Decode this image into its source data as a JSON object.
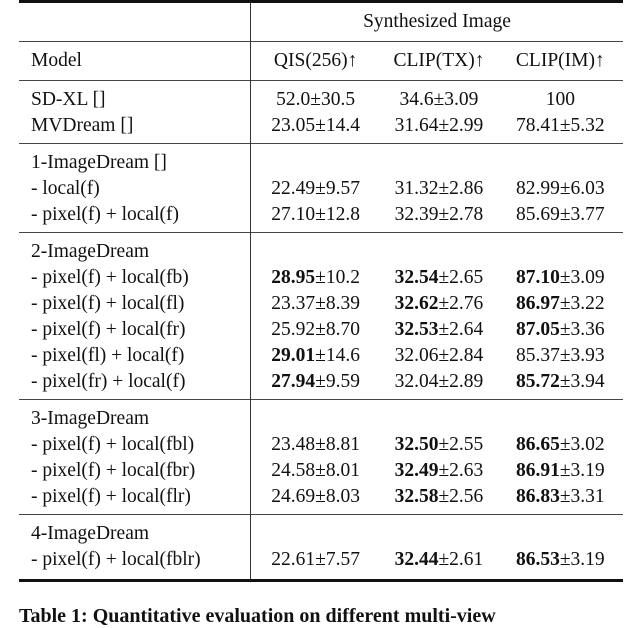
{
  "table": {
    "group_header": "Synthesized Image",
    "columns": [
      "Model",
      "QIS(256)↑",
      "CLIP(TX)↑",
      "CLIP(IM)↑"
    ],
    "sections": [
      {
        "rows": [
          {
            "model": "SD-XL []",
            "qis": {
              "v": "52.0",
              "s": "±30.5",
              "bold": false
            },
            "tx": {
              "v": "34.6",
              "s": "±3.09",
              "bold": false
            },
            "im": {
              "v": "100",
              "s": "",
              "bold": false
            }
          },
          {
            "model": "MVDream []",
            "qis": {
              "v": "23.05",
              "s": "±14.4",
              "bold": false
            },
            "tx": {
              "v": "31.64",
              "s": "±2.99",
              "bold": false
            },
            "im": {
              "v": "78.41",
              "s": "±5.32",
              "bold": false
            }
          }
        ]
      },
      {
        "title": "1-ImageDream []",
        "rows": [
          {
            "model": "- local(f)",
            "qis": {
              "v": "22.49",
              "s": "±9.57",
              "bold": false
            },
            "tx": {
              "v": "31.32",
              "s": "±2.86",
              "bold": false
            },
            "im": {
              "v": "82.99",
              "s": "±6.03",
              "bold": false
            }
          },
          {
            "model": "- pixel(f) + local(f)",
            "qis": {
              "v": "27.10",
              "s": "±12.8",
              "bold": false
            },
            "tx": {
              "v": "32.39",
              "s": "±2.78",
              "bold": false
            },
            "im": {
              "v": "85.69",
              "s": "±3.77",
              "bold": false
            }
          }
        ]
      },
      {
        "title": "2-ImageDream",
        "rows": [
          {
            "model": "- pixel(f) + local(fb)",
            "qis": {
              "v": "28.95",
              "s": "±10.2",
              "bold": true
            },
            "tx": {
              "v": "32.54",
              "s": "±2.65",
              "bold": true
            },
            "im": {
              "v": "87.10",
              "s": "±3.09",
              "bold": true
            }
          },
          {
            "model": "- pixel(f) + local(fl)",
            "qis": {
              "v": "23.37",
              "s": "±8.39",
              "bold": false
            },
            "tx": {
              "v": "32.62",
              "s": "±2.76",
              "bold": true
            },
            "im": {
              "v": "86.97",
              "s": "±3.22",
              "bold": true
            }
          },
          {
            "model": "- pixel(f) + local(fr)",
            "qis": {
              "v": "25.92",
              "s": "±8.70",
              "bold": false
            },
            "tx": {
              "v": "32.53",
              "s": "±2.64",
              "bold": true
            },
            "im": {
              "v": "87.05",
              "s": "±3.36",
              "bold": true
            }
          },
          {
            "model": "- pixel(fl) + local(f)",
            "qis": {
              "v": "29.01",
              "s": "±14.6",
              "bold": true
            },
            "tx": {
              "v": "32.06",
              "s": "±2.84",
              "bold": false
            },
            "im": {
              "v": "85.37",
              "s": "±3.93",
              "bold": false
            }
          },
          {
            "model": "- pixel(fr) + local(f)",
            "qis": {
              "v": "27.94",
              "s": "±9.59",
              "bold": true
            },
            "tx": {
              "v": "32.04",
              "s": "±2.89",
              "bold": false
            },
            "im": {
              "v": "85.72",
              "s": "±3.94",
              "bold": true
            }
          }
        ]
      },
      {
        "title": "3-ImageDream",
        "rows": [
          {
            "model": "- pixel(f) + local(fbl)",
            "qis": {
              "v": "23.48",
              "s": "±8.81",
              "bold": false
            },
            "tx": {
              "v": "32.50",
              "s": "±2.55",
              "bold": true
            },
            "im": {
              "v": "86.65",
              "s": "±3.02",
              "bold": true
            }
          },
          {
            "model": "- pixel(f) + local(fbr)",
            "qis": {
              "v": "24.58",
              "s": "±8.01",
              "bold": false
            },
            "tx": {
              "v": "32.49",
              "s": "±2.63",
              "bold": true
            },
            "im": {
              "v": "86.91",
              "s": "±3.19",
              "bold": true
            }
          },
          {
            "model": "- pixel(f) + local(flr)",
            "qis": {
              "v": "24.69",
              "s": "±8.03",
              "bold": false
            },
            "tx": {
              "v": "32.58",
              "s": "±2.56",
              "bold": true
            },
            "im": {
              "v": "86.83",
              "s": "±3.31",
              "bold": true
            }
          }
        ]
      },
      {
        "title": "4-ImageDream",
        "rows": [
          {
            "model": "- pixel(f) + local(fblr)",
            "qis": {
              "v": "22.61",
              "s": "±7.57",
              "bold": false
            },
            "tx": {
              "v": "32.44",
              "s": "±2.61",
              "bold": true
            },
            "im": {
              "v": "86.53",
              "s": "±3.19",
              "bold": true
            }
          }
        ]
      }
    ]
  },
  "caption": "Table 1: Quantitative evaluation on different multi-view"
}
